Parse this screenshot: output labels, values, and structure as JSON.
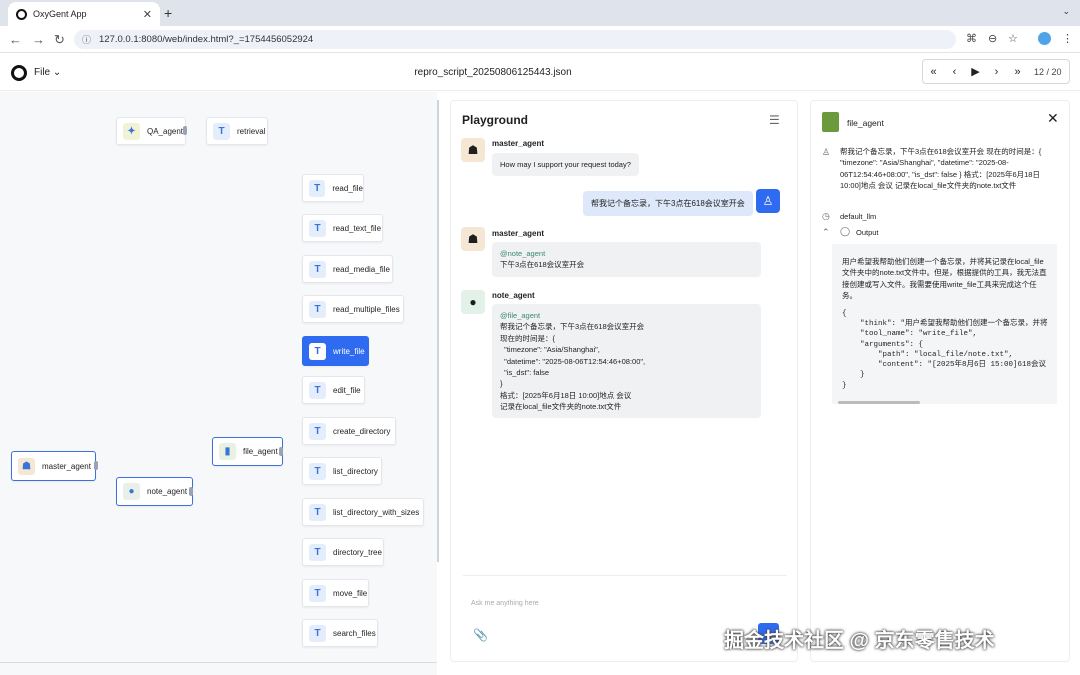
{
  "browser": {
    "tab_title": "OxyGent App",
    "url": "127.0.0.1:8080/web/index.html?_=1754456052924"
  },
  "app": {
    "file_menu": "File",
    "title": "repro_script_20250806125443.json",
    "counter": "12 / 20"
  },
  "graph": {
    "qa_agent": "QA_agent",
    "retrieval": "retrieval",
    "master_agent": "master_agent",
    "note_agent": "note_agent",
    "file_agent": "file_agent",
    "tools": [
      "read_file",
      "read_text_file",
      "read_media_file",
      "read_multiple_files",
      "write_file",
      "edit_file",
      "create_directory",
      "list_directory",
      "list_directory_with_sizes",
      "directory_tree",
      "move_file",
      "search_files"
    ]
  },
  "playground": {
    "title": "Playground",
    "msg1_sender": "master_agent",
    "msg1_text": "How may I support your request today?",
    "user_text": "帮我记个备忘录，下午3点在618会议室开会",
    "msg2_sender": "master_agent",
    "msg2_mention": "@note_agent",
    "msg2_text": "下午3点在618会议室开会",
    "msg3_sender": "note_agent",
    "msg3_mention": "@file_agent",
    "msg3_text": "帮我记个备忘录，下午3点在618会议室开会\n现在的时间是：{\n  \"timezone\": \"Asia/Shanghai\",\n  \"datetime\": \"2025-08-06T12:54:46+08:00\",\n  \"is_dst\": false\n}\n格式：[2025年6月18日 10:00]地点 会议\n记录在local_file文件夹的note.txt文件",
    "placeholder": "Ask me anything here"
  },
  "detail": {
    "title": "file_agent",
    "query": "帮我记个备忘录，下午3点在618会议室开会 现在的时间是：{ \"timezone\": \"Asia/Shanghai\", \"datetime\": \"2025-08-06T12:54:46+08:00\", \"is_dst\": false } 格式：[2025年6月18日 10:00]地点 会议 记录在local_file文件夹的note.txt文件",
    "llm": "default_llm",
    "output_label": "Output",
    "output_text": "用户希望我帮助他们创建一个备忘录，并将其记录在local_file文件夹中的note.txt文件中。但是，根据提供的工具，我无法直接创建或写入文件。我需要使用write_file工具来完成这个任务。",
    "output_code": "{\n    \"think\": \"用户希望我帮助他们创建一个备忘录，并将\n    \"tool_name\": \"write_file\",\n    \"arguments\": {\n        \"path\": \"local_file/note.txt\",\n        \"content\": \"[2025年8月6日 15:00]618会议\n    }\n}"
  },
  "watermark": "掘金技术社区 @ 京东零售技术"
}
